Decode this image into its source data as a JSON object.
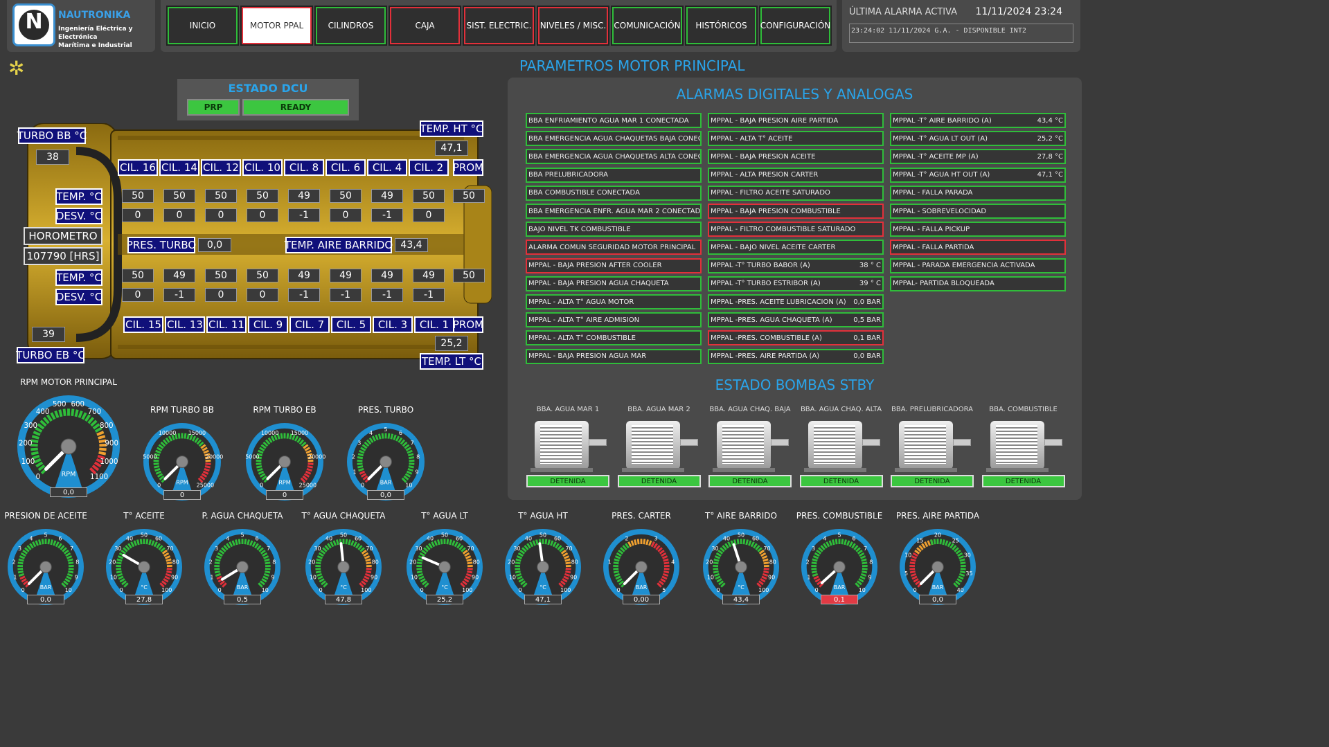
{
  "brand": {
    "name": "NAUTRONIKA",
    "sub1": "Ingeniería Eléctrica y Electrónica",
    "sub2": "Marítima e Industrial"
  },
  "nav": [
    {
      "label": "INICIO",
      "state": "green"
    },
    {
      "label": "MOTOR PPAL",
      "state": "active"
    },
    {
      "label": "CILINDROS",
      "state": "green"
    },
    {
      "label": "CAJA",
      "state": "red"
    },
    {
      "label": "SIST. ELECTRIC.",
      "state": "red"
    },
    {
      "label": "NIVELES / MISC.",
      "state": "red"
    },
    {
      "label": "COMUNICACIÓN",
      "state": "green"
    },
    {
      "label": "HISTÓRICOS",
      "state": "green"
    },
    {
      "label": "CONFIGURACIÓN",
      "state": "green"
    }
  ],
  "alarm": {
    "title": "ÚLTIMA ALARMA ACTIVA",
    "datetime": "11/11/2024 23:24",
    "last": "23:24:02  11/11/2024   G.A. - DISPONIBLE INT2"
  },
  "page_title": "PARAMETROS MOTOR PRINCIPAL",
  "dcu": {
    "title": "ESTADO DCU",
    "mode": "PRP",
    "status": "READY"
  },
  "engine": {
    "turbo_bb_label": "TURBO BB °C",
    "turbo_bb": "38",
    "turbo_eb_label": "TURBO EB °C",
    "turbo_eb": "39",
    "temp_ht_label": "TEMP. HT °C",
    "temp_ht": "47,1",
    "temp_lt_label": "TEMP. LT °C",
    "temp_lt": "25,2",
    "temp_label": "TEMP. °C",
    "desv_label": "DESV. °C",
    "horometro_label": "HOROMETRO",
    "horometro": "107790 [HRS]",
    "pres_turbo_label": "PRES. TURBO",
    "pres_turbo": "0,0",
    "temp_aire_label": "TEMP. AIRE BARRIDO",
    "temp_aire": "43,4",
    "prom_label": "PROM",
    "top_cyl": [
      "CIL. 16",
      "CIL. 14",
      "CIL. 12",
      "CIL. 10",
      "CIL. 8",
      "CIL. 6",
      "CIL. 4",
      "CIL. 2"
    ],
    "top_temp": [
      "50",
      "50",
      "50",
      "50",
      "49",
      "50",
      "49",
      "50"
    ],
    "top_desv": [
      "0",
      "0",
      "0",
      "0",
      "-1",
      "0",
      "-1",
      "0"
    ],
    "top_prom": "50",
    "bot_cyl": [
      "CIL. 15",
      "CIL. 13",
      "CIL. 11",
      "CIL. 9",
      "CIL. 7",
      "CIL. 5",
      "CIL. 3",
      "CIL. 1"
    ],
    "bot_temp": [
      "50",
      "49",
      "50",
      "50",
      "49",
      "49",
      "49",
      "49"
    ],
    "bot_desv": [
      "0",
      "-1",
      "0",
      "0",
      "-1",
      "-1",
      "-1",
      "-1"
    ],
    "bot_prom": "50"
  },
  "alarms_title": "ALARMAS DIGITALES Y ANALOGAS",
  "alarms": [
    [
      {
        "t": "BBA ENFRIAMIENTO AGUA MAR 1 CONECTADA",
        "v": "",
        "red": false
      },
      {
        "t": "BBA EMERGENCIA AGUA CHAQUETAS BAJA CONECTAD",
        "v": "",
        "red": false
      },
      {
        "t": "BBA EMERGENCIA AGUA CHAQUETAS ALTA CONECTAD",
        "v": "",
        "red": false
      },
      {
        "t": "BBA PRELUBRICADORA",
        "v": "",
        "red": false
      },
      {
        "t": "BBA COMBUSTIBLE CONECTADA",
        "v": "",
        "red": false
      },
      {
        "t": "BBA EMERGENCIA ENFR. AGUA MAR 2 CONECTADA",
        "v": "",
        "red": false
      },
      {
        "t": "BAJO NIVEL TK COMBUSTIBLE",
        "v": "",
        "red": false
      },
      {
        "t": "ALARMA COMUN SEGURIDAD MOTOR PRINCIPAL",
        "v": "",
        "red": true
      },
      {
        "t": "MPPAL - BAJA PRESION AFTER COOLER",
        "v": "",
        "red": true
      },
      {
        "t": "MPPAL - BAJA PRESION AGUA CHAQUETA",
        "v": "",
        "red": false
      },
      {
        "t": "MPPAL - ALTA T° AGUA MOTOR",
        "v": "",
        "red": false
      },
      {
        "t": "MPPAL - ALTA T° AIRE ADMISION",
        "v": "",
        "red": false
      },
      {
        "t": "MPPAL - ALTA T° COMBUSTIBLE",
        "v": "",
        "red": false
      },
      {
        "t": "MPPAL - BAJA PRESION AGUA MAR",
        "v": "",
        "red": false
      }
    ],
    [
      {
        "t": "MPPAL - BAJA PRESION AIRE PARTIDA",
        "v": "",
        "red": false
      },
      {
        "t": "MPPAL - ALTA T° ACEITE",
        "v": "",
        "red": false
      },
      {
        "t": "MPPAL - BAJA PRESION ACEITE",
        "v": "",
        "red": false
      },
      {
        "t": "MPPAL - ALTA PRESION CARTER",
        "v": "",
        "red": false
      },
      {
        "t": "MPPAL - FILTRO ACEITE SATURADO",
        "v": "",
        "red": false
      },
      {
        "t": "MPPAL - BAJA PRESION COMBUSTIBLE",
        "v": "",
        "red": true
      },
      {
        "t": "MPPAL - FILTRO COMBUSTIBLE SATURADO",
        "v": "",
        "red": true
      },
      {
        "t": "MPPAL - BAJO NIVEL ACEITE CARTER",
        "v": "",
        "red": false
      },
      {
        "t": "MPPAL -T° TURBO BABOR (A)",
        "v": "38 ° C",
        "red": false
      },
      {
        "t": "MPPAL -T° TURBO ESTRIBOR (A)",
        "v": "39 ° C",
        "red": false
      },
      {
        "t": "MPPAL -PRES. ACEITE LUBRICACION (A)",
        "v": "0,0 BAR",
        "red": false
      },
      {
        "t": "MPPAL -PRES. AGUA CHAQUETA (A)",
        "v": "0,5 BAR",
        "red": false
      },
      {
        "t": "MPPAL -PRES. COMBUSTIBLE (A)",
        "v": "0,1 BAR",
        "red": true
      },
      {
        "t": "MPPAL -PRES. AIRE PARTIDA (A)",
        "v": "0,0 BAR",
        "red": false
      }
    ],
    [
      {
        "t": "MPPAL -T° AIRE BARRIDO (A)",
        "v": "43,4 °C",
        "red": false
      },
      {
        "t": "MPPAL -T° AGUA LT OUT (A)",
        "v": "25,2 °C",
        "red": false
      },
      {
        "t": "MPPAL -T° ACEITE MP (A)",
        "v": "27,8 °C",
        "red": false
      },
      {
        "t": "MPPAL -T° AGUA HT OUT (A)",
        "v": "47,1 °C",
        "red": false
      },
      {
        "t": "MPPAL - FALLA PARADA",
        "v": "",
        "red": false
      },
      {
        "t": "MPPAL - SOBREVELOCIDAD",
        "v": "",
        "red": false
      },
      {
        "t": "MPPAL - FALLA PICKUP",
        "v": "",
        "red": false
      },
      {
        "t": "MPPAL - FALLA PARTIDA",
        "v": "",
        "red": true
      },
      {
        "t": "MPPAL - PARADA EMERGENCIA ACTIVADA",
        "v": "",
        "red": false
      },
      {
        "t": "MPPAL- PARTIDA BLOQUEADA",
        "v": "",
        "red": false
      }
    ]
  ],
  "pumps_title": "ESTADO BOMBAS STBY",
  "pumps": [
    {
      "name": "BBA. AGUA MAR 1",
      "status": "DETENIDA"
    },
    {
      "name": "BBA. AGUA MAR 2",
      "status": "DETENIDA"
    },
    {
      "name": "BBA. AGUA CHAQ. BAJA",
      "status": "DETENIDA"
    },
    {
      "name": "BBA. AGUA CHAQ. ALTA",
      "status": "DETENIDA"
    },
    {
      "name": "BBA. PRELUBRICADORA",
      "status": "DETENIDA"
    },
    {
      "name": "BBA. COMBUSTIBLE",
      "status": "DETENIDA"
    }
  ],
  "gauges": [
    {
      "title": "RPM MOTOR PRINCIPAL",
      "unit": "RPM",
      "value": "0,0",
      "num": 0,
      "min": 0,
      "max": 1100,
      "ticks": [
        "0",
        "100",
        "200",
        "300",
        "400",
        "500",
        "600",
        "700",
        "800",
        "900",
        "1000",
        "1100"
      ],
      "zones": [
        [
          0,
          0.75,
          "#2fbd3a"
        ],
        [
          0.75,
          0.88,
          "#f0a030"
        ],
        [
          0.88,
          1,
          "#e2303a"
        ]
      ]
    },
    {
      "title": "RPM TURBO BB",
      "unit": "RPM",
      "value": "0",
      "num": 0,
      "min": 0,
      "max": 25000,
      "ticks": [
        "0",
        "5000",
        "10000",
        "15000",
        "20000",
        "25000"
      ],
      "zones": [
        [
          0,
          0.7,
          "#2fbd3a"
        ],
        [
          0.7,
          0.85,
          "#f0a030"
        ],
        [
          0.85,
          1,
          "#e2303a"
        ]
      ]
    },
    {
      "title": "RPM TURBO EB",
      "unit": "RPM",
      "value": "0",
      "num": 0,
      "min": 0,
      "max": 25000,
      "ticks": [
        "0",
        "5000",
        "10000",
        "15000",
        "20000",
        "25000"
      ],
      "zones": [
        [
          0,
          0.7,
          "#2fbd3a"
        ],
        [
          0.7,
          0.85,
          "#f0a030"
        ],
        [
          0.85,
          1,
          "#e2303a"
        ]
      ]
    },
    {
      "title": "PRES. TURBO",
      "unit": "BAR",
      "value": "0,0",
      "num": 0,
      "min": 0,
      "max": 10,
      "ticks": [
        "0",
        "1",
        "2",
        "3",
        "4",
        "5",
        "6",
        "7",
        "8",
        "9",
        "10"
      ],
      "zones": [
        [
          0,
          0.1,
          "#e2303a"
        ],
        [
          0.1,
          1,
          "#2fbd3a"
        ]
      ]
    },
    {
      "title": "PRESION DE ACEITE",
      "unit": "BAR",
      "value": "0,0",
      "num": 0,
      "min": 0,
      "max": 10,
      "ticks": [
        "0",
        "1",
        "2",
        "3",
        "4",
        "5",
        "6",
        "7",
        "8",
        "9",
        "10"
      ],
      "zones": [
        [
          0,
          0.1,
          "#e2303a"
        ],
        [
          0.1,
          1,
          "#2fbd3a"
        ]
      ]
    },
    {
      "title": "T° ACEITE",
      "unit": "°C",
      "value": "27,8",
      "num": 27.8,
      "min": 0,
      "max": 100,
      "ticks": [
        "0",
        "10",
        "20",
        "30",
        "40",
        "50",
        "60",
        "70",
        "80",
        "90",
        "100"
      ],
      "zones": [
        [
          0,
          0.7,
          "#2fbd3a"
        ],
        [
          0.7,
          0.85,
          "#f0a030"
        ],
        [
          0.85,
          1,
          "#e2303a"
        ]
      ]
    },
    {
      "title": "P. AGUA CHAQUETA",
      "unit": "BAR",
      "value": "0,5",
      "num": 0.5,
      "min": 0,
      "max": 10,
      "ticks": [
        "0",
        "1",
        "2",
        "3",
        "4",
        "5",
        "6",
        "7",
        "8",
        "9",
        "10"
      ],
      "zones": [
        [
          0,
          0.1,
          "#e2303a"
        ],
        [
          0.1,
          1,
          "#2fbd3a"
        ]
      ]
    },
    {
      "title": "T° AGUA CHAQUETA",
      "unit": "°C",
      "value": "47,8",
      "num": 47.8,
      "min": 0,
      "max": 100,
      "ticks": [
        "0",
        "10",
        "20",
        "30",
        "40",
        "50",
        "60",
        "70",
        "80",
        "90",
        "100"
      ],
      "zones": [
        [
          0,
          0.7,
          "#2fbd3a"
        ],
        [
          0.7,
          0.85,
          "#f0a030"
        ],
        [
          0.85,
          1,
          "#e2303a"
        ]
      ]
    },
    {
      "title": "T° AGUA LT",
      "unit": "°C",
      "value": "25,2",
      "num": 25.2,
      "min": 0,
      "max": 100,
      "ticks": [
        "0",
        "10",
        "20",
        "30",
        "40",
        "50",
        "60",
        "70",
        "80",
        "90",
        "100"
      ],
      "zones": [
        [
          0,
          0.7,
          "#2fbd3a"
        ],
        [
          0.7,
          0.85,
          "#f0a030"
        ],
        [
          0.85,
          1,
          "#e2303a"
        ]
      ]
    },
    {
      "title": "T° AGUA HT",
      "unit": "°C",
      "value": "47,1",
      "num": 47.1,
      "min": 0,
      "max": 100,
      "ticks": [
        "0",
        "10",
        "20",
        "30",
        "40",
        "50",
        "60",
        "70",
        "80",
        "90",
        "100"
      ],
      "zones": [
        [
          0,
          0.7,
          "#2fbd3a"
        ],
        [
          0.7,
          0.85,
          "#f0a030"
        ],
        [
          0.85,
          1,
          "#e2303a"
        ]
      ]
    },
    {
      "title": "PRES. CARTER",
      "unit": "BAR",
      "value": "0,00",
      "num": 0,
      "min": 0,
      "max": 5,
      "ticks": [
        "0",
        "1",
        "2",
        "3",
        "4",
        "5"
      ],
      "zones": [
        [
          0,
          0.4,
          "#2fbd3a"
        ],
        [
          0.4,
          0.6,
          "#f0a030"
        ],
        [
          0.6,
          1,
          "#e2303a"
        ]
      ]
    },
    {
      "title": "T° AIRE BARRIDO",
      "unit": "°C",
      "value": "43,4",
      "num": 43.4,
      "min": 0,
      "max": 100,
      "ticks": [
        "0",
        "10",
        "20",
        "30",
        "40",
        "50",
        "60",
        "70",
        "80",
        "90",
        "100"
      ],
      "zones": [
        [
          0,
          0.7,
          "#2fbd3a"
        ],
        [
          0.7,
          0.85,
          "#f0a030"
        ],
        [
          0.85,
          1,
          "#e2303a"
        ]
      ]
    },
    {
      "title": "PRES. COMBUSTIBLE",
      "unit": "BAR",
      "value": "0,1",
      "num": 0.1,
      "min": 0,
      "max": 10,
      "ticks": [
        "0",
        "1",
        "2",
        "3",
        "4",
        "5",
        "6",
        "7",
        "8",
        "9",
        "10"
      ],
      "zones": [
        [
          0,
          0.1,
          "#e2303a"
        ],
        [
          0.1,
          1,
          "#2fbd3a"
        ]
      ],
      "alarm": true
    },
    {
      "title": "PRES. AIRE PARTIDA",
      "unit": "BAR",
      "value": "0,0",
      "num": 0,
      "min": 0,
      "max": 40,
      "ticks": [
        "0",
        "5",
        "10",
        "15",
        "20",
        "25",
        "30",
        "35",
        "40"
      ],
      "zones": [
        [
          0,
          0.3,
          "#e2303a"
        ],
        [
          0.3,
          0.45,
          "#f0a030"
        ],
        [
          0.45,
          1,
          "#2fbd3a"
        ]
      ]
    }
  ],
  "colors": {
    "accent": "#2aa4ea",
    "ok": "#2fbd3a",
    "alarm": "#e2303a",
    "engine": "#c9a227"
  }
}
